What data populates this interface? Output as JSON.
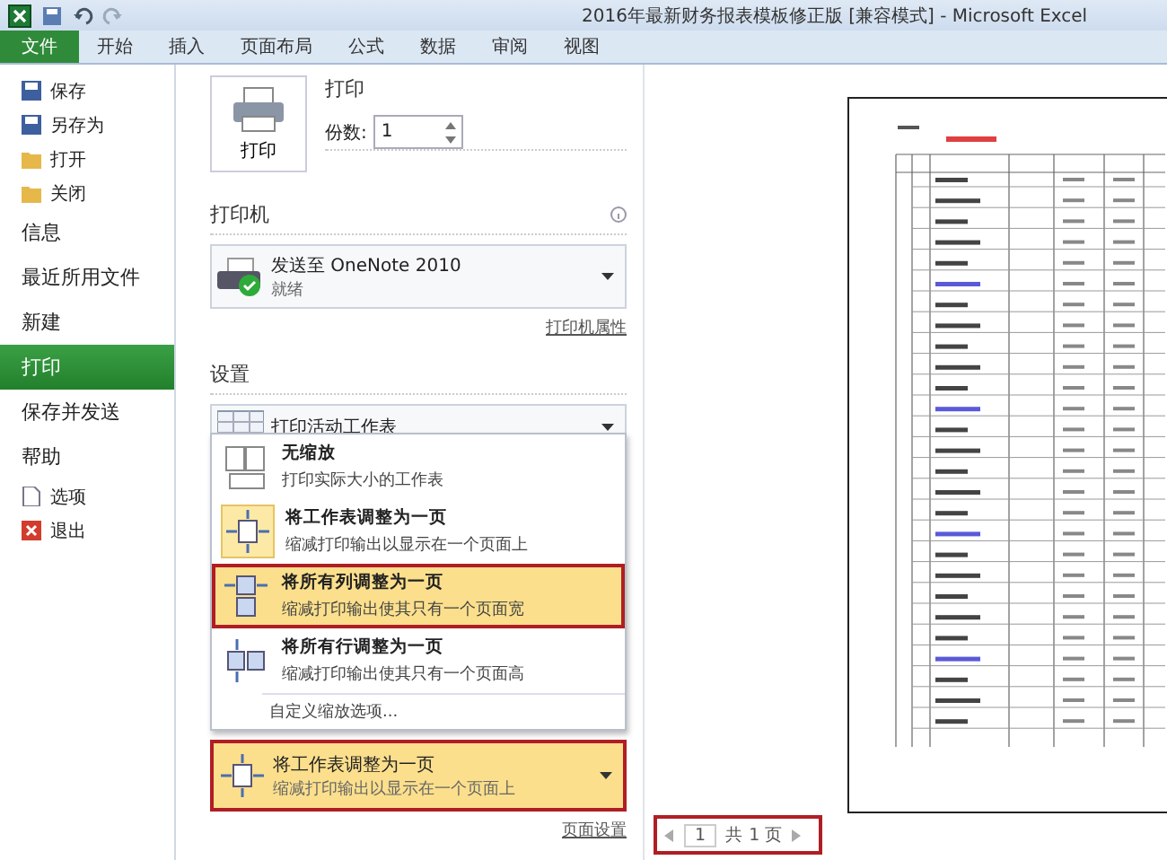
{
  "window": {
    "title": "2016年最新财务报表模板修正版  [兼容模式]  -  Microsoft Excel"
  },
  "ribbon_tabs": [
    {
      "label": "文件",
      "selected": true
    },
    {
      "label": "开始",
      "selected": false
    },
    {
      "label": "插入",
      "selected": false
    },
    {
      "label": "页面布局",
      "selected": false
    },
    {
      "label": "公式",
      "selected": false
    },
    {
      "label": "数据",
      "selected": false
    },
    {
      "label": "审阅",
      "selected": false
    },
    {
      "label": "视图",
      "selected": false
    }
  ],
  "sidebar": {
    "items": [
      {
        "label": "保存",
        "kind": "command",
        "selected": false
      },
      {
        "label": "另存为",
        "kind": "command",
        "selected": false
      },
      {
        "label": "打开",
        "kind": "command",
        "selected": false
      },
      {
        "label": "关闭",
        "kind": "command",
        "selected": false
      },
      {
        "label": "信息",
        "kind": "page",
        "selected": false
      },
      {
        "label": "最近所用文件",
        "kind": "page",
        "selected": false
      },
      {
        "label": "新建",
        "kind": "page",
        "selected": false
      },
      {
        "label": "打印",
        "kind": "page",
        "selected": true
      },
      {
        "label": "保存并发送",
        "kind": "page",
        "selected": false
      },
      {
        "label": "帮助",
        "kind": "page",
        "selected": false
      },
      {
        "label": "选项",
        "kind": "command",
        "selected": false
      },
      {
        "label": "退出",
        "kind": "command",
        "selected": false
      }
    ]
  },
  "print": {
    "button": "打印",
    "heading": "打印",
    "copies_label": "份数:",
    "copies": "1"
  },
  "printer": {
    "heading": "打印机",
    "name": "发送至 OneNote 2010",
    "status": "就绪",
    "properties_link": "打印机属性"
  },
  "settings": {
    "heading": "设置",
    "what": "打印活动工作表",
    "scaling_options": [
      {
        "title": "无缩放",
        "subtitle": "打印实际大小的工作表",
        "selected": false,
        "highlighted": false,
        "marked": false
      },
      {
        "title": "将工作表调整为一页",
        "subtitle": "缩减打印输出以显示在一个页面上",
        "selected": true,
        "highlighted": false,
        "marked": false
      },
      {
        "title": "将所有列调整为一页",
        "subtitle": "缩减打印输出使其只有一个页面宽",
        "selected": false,
        "highlighted": true,
        "marked": true
      },
      {
        "title": "将所有行调整为一页",
        "subtitle": "缩减打印输出使其只有一个页面高",
        "selected": false,
        "highlighted": false,
        "marked": false
      }
    ],
    "custom_scaling": "自定义缩放选项...",
    "scaling": {
      "title": "将工作表调整为一页",
      "subtitle": "缩减打印输出以显示在一个页面上",
      "marked": true
    },
    "page_setup_link": "页面设置"
  },
  "preview": {
    "page": "1",
    "total": "共 1 页",
    "marked": true
  }
}
